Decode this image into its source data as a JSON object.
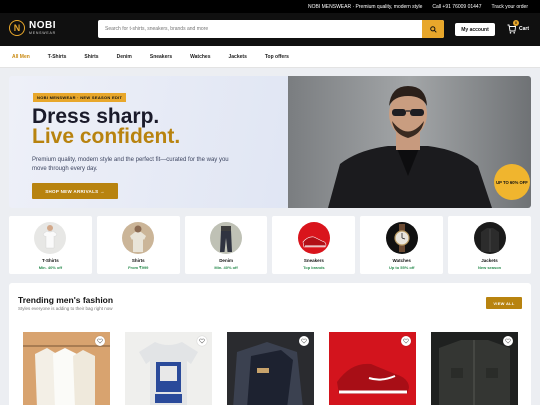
{
  "topbar": {
    "brand_line": "NOBI MENSWEAR · Premium quality, modern style",
    "phone": "Call +91 76009 01447",
    "track": "Track your order"
  },
  "header": {
    "logo_letter": "N",
    "logo_name": "NOBI",
    "logo_sub": "MENSWEAR",
    "search_placeholder": "Search for t-shirts, sneakers, brands and more",
    "account_label": "My account",
    "cart_label": "Cart",
    "cart_count": "0"
  },
  "nav": {
    "items": [
      "All Men",
      "T-Shirts",
      "Shirts",
      "Denim",
      "Sneakers",
      "Watches",
      "Jackets",
      "Top offers"
    ],
    "active": "All Men"
  },
  "hero": {
    "badge": "NOBI MENSWEAR · NEW SEASON EDIT",
    "title_line1": "Dress sharp.",
    "title_line2": "Live confident.",
    "description": "Premium quality, modern style and the perfect fit—curated for the way you move through every day.",
    "cta": "SHOP NEW ARRIVALS →",
    "promo": "UP TO 60% OFF"
  },
  "categories": [
    {
      "name": "T-Shirts",
      "offer": "Min. 40% off"
    },
    {
      "name": "Shirts",
      "offer": "From ₹999"
    },
    {
      "name": "Denim",
      "offer": "Min. 40% off"
    },
    {
      "name": "Sneakers",
      "offer": "Top brands"
    },
    {
      "name": "Watches",
      "offer": "Up to 55% off"
    },
    {
      "name": "Jackets",
      "offer": "New season"
    }
  ],
  "trending": {
    "title": "Trending men's fashion",
    "subtitle": "Styles everyone is adding to their bag right now",
    "view_all": "VIEW ALL"
  },
  "colors": {
    "accent": "#b8830f",
    "accent_light": "#e8a72b",
    "offer_green": "#2a8c4f",
    "header_bg": "#101010"
  },
  "icons": {
    "search": "search-icon",
    "cart": "cart-icon",
    "wishlist": "heart-icon"
  }
}
